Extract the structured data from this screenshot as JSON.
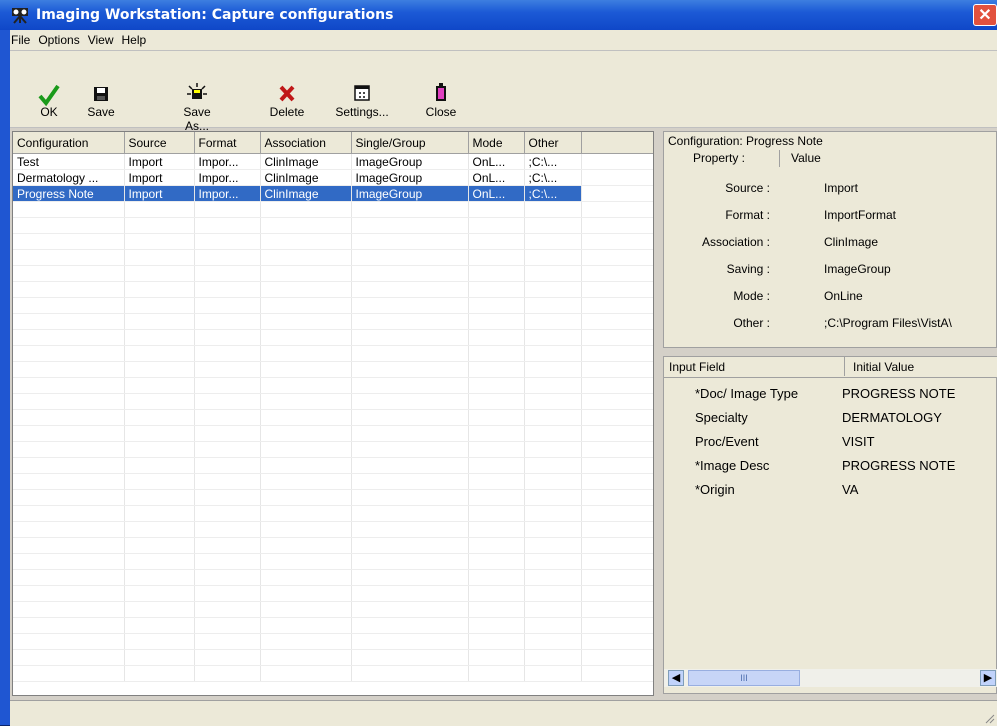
{
  "window": {
    "title": "Imaging Workstation: Capture configurations",
    "close_label": "✕"
  },
  "menu": [
    "File",
    "Options",
    "View",
    "Help"
  ],
  "toolbar": {
    "ok": "OK",
    "save": "Save",
    "save_as": "Save As...",
    "delete": "Delete",
    "settings": "Settings...",
    "close": "Close"
  },
  "grid": {
    "columns": [
      "Configuration",
      "Source",
      "Format",
      "Association",
      "Single/Group",
      "Mode",
      "Other"
    ],
    "rows": [
      [
        "Test",
        "Import",
        "Impor...",
        "ClinImage",
        "ImageGroup",
        "OnL...",
        ";C:\\..."
      ],
      [
        "Dermatology ...",
        "Import",
        "Impor...",
        "ClinImage",
        "ImageGroup",
        "OnL...",
        ";C:\\..."
      ],
      [
        "Progress Note",
        "Import",
        "Impor...",
        "ClinImage",
        "ImageGroup",
        "OnL...",
        ";C:\\..."
      ]
    ],
    "selected_row": 2
  },
  "properties": {
    "title": "Configuration: Progress Note",
    "col_property": "Property :",
    "col_value": "Value",
    "items": [
      {
        "key": "Source :",
        "value": "Import"
      },
      {
        "key": "Format :",
        "value": "ImportFormat"
      },
      {
        "key": "Association :",
        "value": "ClinImage"
      },
      {
        "key": "Saving :",
        "value": "ImageGroup"
      },
      {
        "key": "Mode :",
        "value": "OnLine"
      },
      {
        "key": "Other :",
        "value": ";C:\\Program Files\\VistA\\"
      }
    ]
  },
  "fields": {
    "col_input": "Input Field",
    "col_initial": "Initial Value",
    "items": [
      {
        "key": "*Doc/ Image Type",
        "value": "PROGRESS NOTE"
      },
      {
        "key": "Specialty",
        "value": "DERMATOLOGY"
      },
      {
        "key": "Proc/Event",
        "value": "VISIT"
      },
      {
        "key": "*Image Desc",
        "value": "PROGRESS NOTE"
      },
      {
        "key": "*Origin",
        "value": "VA"
      }
    ]
  },
  "scroll_thumb": "III",
  "colors": {
    "selection": "#316ac5",
    "title_bar": "#1c5ad6"
  }
}
